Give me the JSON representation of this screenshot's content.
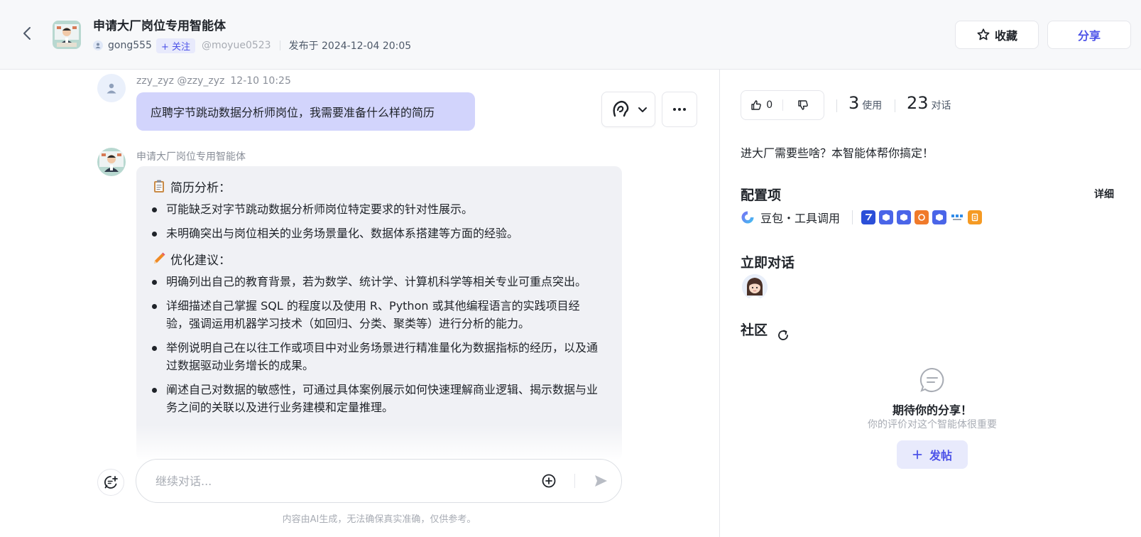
{
  "header": {
    "title": "申请大厂岗位专用智能体",
    "author": "gong555",
    "follow_label": "+ 关注",
    "handle": "@moyue0523",
    "published": "发布于 2024-12-04 20:05",
    "favorite_label": "收藏",
    "share_label": "分享"
  },
  "chat": {
    "user_name": "zzy_zyz @zzy_zyz",
    "user_time": "12-10 10:25",
    "user_message": "应聘字节跳动数据分析师岗位，我需要准备什么样的简历",
    "bot_name": "申请大厂岗位专用智能体",
    "section1_title": "简历分析：",
    "section1_items": [
      "可能缺乏对字节跳动数据分析师岗位特定要求的针对性展示。",
      "未明确突出与岗位相关的业务场景量化、数据体系搭建等方面的经验。"
    ],
    "section2_title": "优化建议：",
    "section2_items": [
      "明确列出自己的教育背景，若为数学、统计学、计算机科学等相关专业可重点突出。",
      "详细描述自己掌握 SQL 的程度以及使用 R、Python 或其他编程语言的实践项目经验，强调运用机器学习技术（如回归、分类、聚类等）进行分析的能力。",
      "举例说明自己在以往工作或项目中对业务场景进行精准量化为数据指标的经历，以及通过数据驱动业务增长的成果。",
      "阐述自己对数据的敏感性，可通过具体案例展示如何快速理解商业逻辑、揭示数据与业务之间的关联以及进行业务建模和定量推理。"
    ],
    "input_placeholder": "继续对话...",
    "disclaimer": "内容由AI生成，无法确保真实准确，仅供参考。"
  },
  "panel": {
    "likes": "0",
    "uses_num": "3",
    "uses_label": "使用",
    "chats_num": "23",
    "chats_label": "对话",
    "description": "进大厂需要些啥？本智能体帮你搞定！",
    "config_title": "配置项",
    "detail_label": "详细",
    "model_label": "豆包・工具调用",
    "talk_title": "立即对话",
    "community_title": "社区",
    "empty_title": "期待你的分享！",
    "empty_sub": "你的评价对这个智能体很重要",
    "post_label": "发帖"
  },
  "colors": {
    "accent": "#4d53e8",
    "user_bubble": "#d2d4fc",
    "bot_bubble": "#f0f1f5"
  },
  "icons": [
    "back-arrow-icon",
    "star-icon",
    "voice-icon",
    "chevron-down-icon",
    "more-icon",
    "clipboard-icon",
    "pencil-icon",
    "new-chat-icon",
    "add-circle-icon",
    "send-icon",
    "thumb-up-icon",
    "thumb-down-icon",
    "doubao-logo-icon",
    "refresh-icon",
    "comment-icon",
    "plus-icon"
  ]
}
